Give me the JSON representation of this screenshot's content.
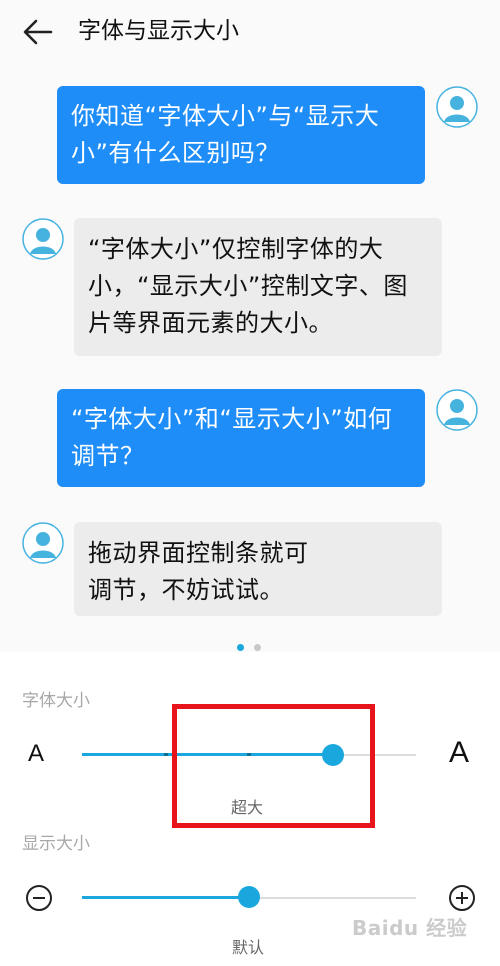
{
  "header": {
    "title": "字体与显示大小",
    "back_icon": "arrow-left-icon"
  },
  "chat": {
    "messages": [
      {
        "from": "user",
        "text": "你知道“字体大小”与“显示大小”有什么区别吗？"
      },
      {
        "from": "assistant",
        "text": "“字体大小”仅控制字体的大小，“显示大小”控制文字、图片等界面元素的大小。"
      },
      {
        "from": "user",
        "text": "“字体大小”和“显示大小”如何调节？"
      },
      {
        "from": "assistant",
        "text": "拖动界面控制条就可调节，不妨试试。"
      }
    ],
    "user_bubble_color": "#1e8df7",
    "assistant_bubble_color": "#ececec",
    "avatar_color": "#46b3df"
  },
  "pager": {
    "count": 2,
    "active": 0
  },
  "font_size": {
    "label": "字体大小",
    "small_glyph": "A",
    "large_glyph": "A",
    "steps": 5,
    "selected_step": 4,
    "value_label": "超大"
  },
  "display_size": {
    "label": "显示大小",
    "decrease_icon": "minus-circle-icon",
    "increase_icon": "plus-circle-icon",
    "steps": 3,
    "selected_step": 1,
    "value_label": "默认"
  },
  "watermark": {
    "text": "Baidu 经验"
  },
  "colors": {
    "accent": "#1aa7dd",
    "highlight": "#e8141c"
  }
}
